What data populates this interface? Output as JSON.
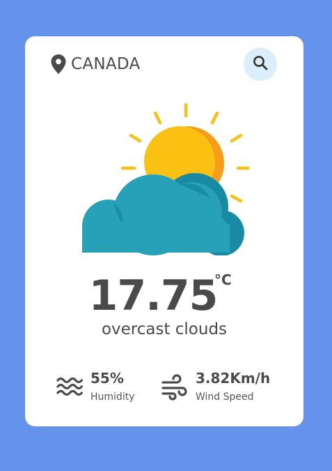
{
  "location": {
    "name": "CANADA",
    "icon": "map-pin-icon"
  },
  "search": {
    "icon": "search-icon"
  },
  "weather": {
    "icon": "sun-behind-cloud-icon",
    "temperature": "17.75",
    "unit": "°C",
    "description": "overcast clouds"
  },
  "stats": {
    "humidity": {
      "value": "55%",
      "label": "Humidity",
      "icon": "waves-icon"
    },
    "wind": {
      "value": "3.82Km/h",
      "label": "Wind Speed",
      "icon": "wind-icon"
    }
  },
  "colors": {
    "background": "#6592ea",
    "card": "#ffffff",
    "search_bg": "#daeefb",
    "sun": "#fbc112",
    "sun_shade": "#f59c1c",
    "cloud": "#26a1b8",
    "cloud_shade": "#1a8aa3",
    "text": "#4a4a4a"
  }
}
